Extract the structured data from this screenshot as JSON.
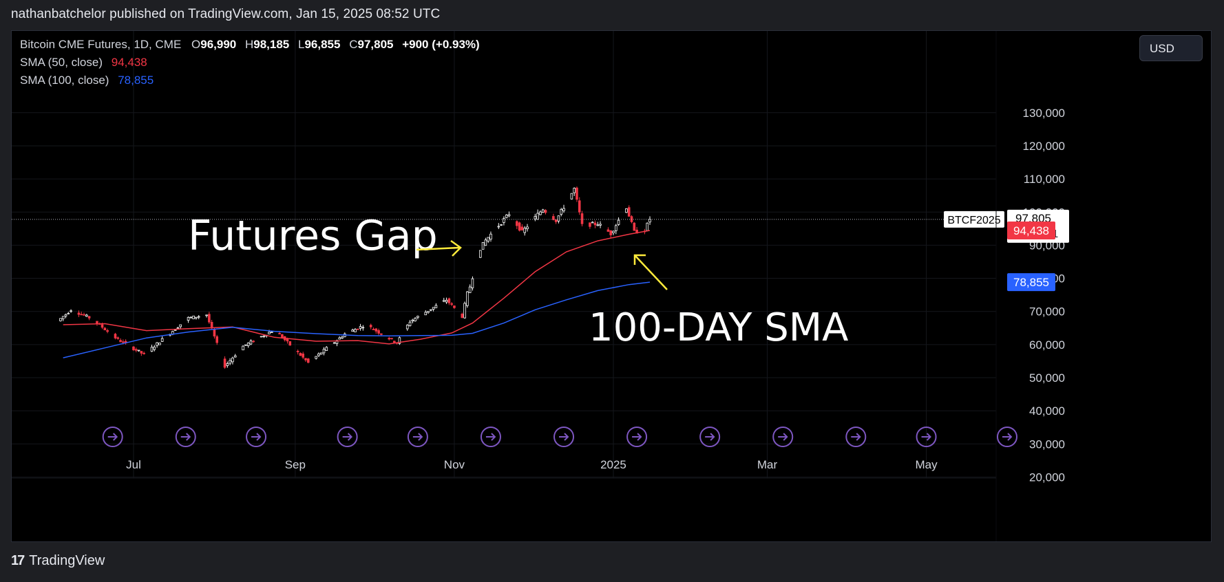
{
  "header": {
    "publisher_line": "nathanbatchelor published on TradingView.com, Jan 15, 2025 08:52 UTC"
  },
  "legend": {
    "symbol": "Bitcoin CME Futures, 1D, CME",
    "ohlc": [
      {
        "key": "O",
        "value": "96,990"
      },
      {
        "key": "H",
        "value": "98,185"
      },
      {
        "key": "L",
        "value": "96,855"
      },
      {
        "key": "C",
        "value": "97,805"
      }
    ],
    "change": "+900 (+0.93%)",
    "sma50_label": "SMA (50, close)",
    "sma50_value": "94,438",
    "sma100_label": "SMA (100, close)",
    "sma100_value": "78,855"
  },
  "currency_button": "USD",
  "footer": {
    "brand": "TradingView"
  },
  "colors": {
    "background": "#000000",
    "up_candle": "#ffffff",
    "down_candle": "#f23645",
    "sma50": "#f23645",
    "sma100": "#2962ff",
    "annotation_arrow": "#ffeb3b",
    "event_icon": "#7e57c2"
  },
  "chart_data": {
    "type": "candlestick",
    "symbol_tag": "BTCF2025",
    "last_price": "97,805",
    "countdown": "13:17:51",
    "y_ticks": [
      "130,000",
      "120,000",
      "110,000",
      "100,000",
      "90,000",
      "80,000",
      "70,000",
      "60,000",
      "50,000",
      "40,000",
      "30,000",
      "20,000"
    ],
    "x_ticks": [
      "Jul",
      "Sep",
      "Nov",
      "2025",
      "Mar",
      "May"
    ],
    "price_labels": [
      {
        "text": "94,438",
        "series": "SMA 50"
      },
      {
        "text": "78,855",
        "series": "SMA 100"
      }
    ],
    "annotations": [
      "Futures Gap",
      "100-DAY SMA"
    ],
    "ylim": [
      20000,
      130000
    ],
    "series": [
      {
        "name": "SMA (50, close)",
        "points": [
          [
            "2024-06-04",
            66000
          ],
          [
            "2024-06-20",
            66300
          ],
          [
            "2024-07-06",
            64200
          ],
          [
            "2024-07-22",
            64800
          ],
          [
            "2024-08-08",
            65300
          ],
          [
            "2024-08-24",
            62200
          ],
          [
            "2024-09-09",
            61000
          ],
          [
            "2024-09-25",
            61200
          ],
          [
            "2024-10-07",
            60200
          ],
          [
            "2024-10-19",
            61600
          ],
          [
            "2024-10-31",
            63500
          ],
          [
            "2024-11-08",
            66500
          ],
          [
            "2024-11-20",
            74000
          ],
          [
            "2024-12-02",
            82000
          ],
          [
            "2024-12-14",
            88000
          ],
          [
            "2024-12-26",
            91300
          ],
          [
            "2025-01-07",
            93300
          ],
          [
            "2025-01-15",
            94438
          ]
        ]
      },
      {
        "name": "SMA (100, close)",
        "points": [
          [
            "2024-06-04",
            56000
          ],
          [
            "2024-06-20",
            59000
          ],
          [
            "2024-07-06",
            62000
          ],
          [
            "2024-07-22",
            63800
          ],
          [
            "2024-08-08",
            65200
          ],
          [
            "2024-08-24",
            64000
          ],
          [
            "2024-09-09",
            63300
          ],
          [
            "2024-09-25",
            62700
          ],
          [
            "2024-10-07",
            62600
          ],
          [
            "2024-10-19",
            62700
          ],
          [
            "2024-10-31",
            62800
          ],
          [
            "2024-11-08",
            63400
          ],
          [
            "2024-11-20",
            66500
          ],
          [
            "2024-12-02",
            70500
          ],
          [
            "2024-12-14",
            73500
          ],
          [
            "2024-12-26",
            76300
          ],
          [
            "2025-01-07",
            78100
          ],
          [
            "2025-01-15",
            78855
          ]
        ]
      }
    ]
  }
}
